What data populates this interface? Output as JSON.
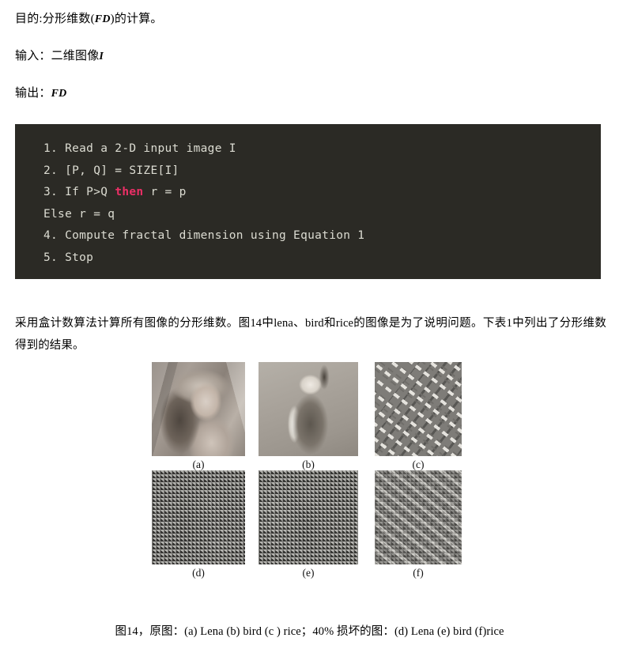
{
  "algorithm": {
    "purpose_label": "目的:",
    "purpose_text": "分形维数(",
    "purpose_var": "FD",
    "purpose_tail": ")的计算。",
    "input_label": "输入：二维图像",
    "input_var": "I",
    "output_label": "输出：",
    "output_var": "FD"
  },
  "code": {
    "line1": "1. Read a 2-D input image I",
    "line2": "2. [P, Q] = SIZE[I]",
    "line3_a": "3. If P>Q ",
    "line3_kw": "then",
    "line3_b": " r = p",
    "line4": "Else r = q",
    "line5": "4. Compute fractal dimension using Equation 1",
    "line6": "5. Stop",
    "background_color": "#2b2a25",
    "text_color": "#dcdcd2",
    "keyword_color": "#ec2f66"
  },
  "paragraph": {
    "text": "采用盒计数算法计算所有图像的分形维数。图14中lena、bird和rice的图像是为了说明问题。下表1中列出了分形维数得到的结果。"
  },
  "figure": {
    "row1": [
      {
        "label": "(a)",
        "subject": "lena-original"
      },
      {
        "label": "(b)",
        "subject": "bird-original"
      },
      {
        "label": "(c)",
        "subject": "rice-original"
      }
    ],
    "row2": [
      {
        "label": "(d)",
        "subject": "lena-corrupted"
      },
      {
        "label": "(e)",
        "subject": "bird-corrupted"
      },
      {
        "label": "(f)",
        "subject": "rice-corrupted"
      }
    ],
    "caption": "图14，原图：(a) Lena (b) bird (c ) rice；40% 损坏的图：(d) Lena (e) bird (f)rice"
  }
}
